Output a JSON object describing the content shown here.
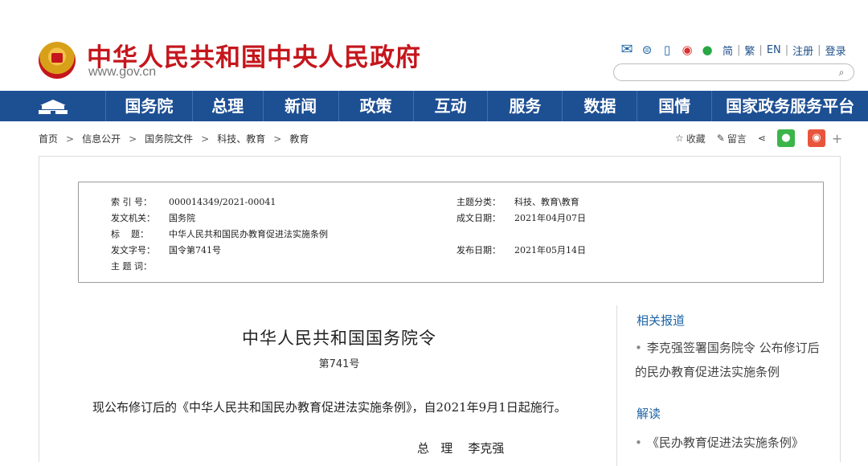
{
  "header": {
    "site_title": "中华人民共和国中央人民政府",
    "site_url": "www.gov.cn",
    "lang_links": [
      "简",
      "繁",
      "EN",
      "注册",
      "登录"
    ],
    "search_placeholder": ""
  },
  "nav": {
    "items": [
      "国务院",
      "总理",
      "新闻",
      "政策",
      "互动",
      "服务",
      "数据",
      "国情",
      "国家政务服务平台"
    ]
  },
  "breadcrumb": [
    "首页",
    "信息公开",
    "国务院文件",
    "科技、教育",
    "教育"
  ],
  "actions": {
    "favorite": "收藏",
    "comment": "留言"
  },
  "meta": {
    "index_label": "索 引 号：",
    "index_value": "000014349/2021-00041",
    "topic_label": "主题分类：",
    "topic_value": "科技、教育\\教育",
    "issuer_label": "发文机关：",
    "issuer_value": "国务院",
    "date_made_label": "成文日期：",
    "date_made_value": "2021年04月07日",
    "title_label": "标    题：",
    "title_value": "中华人民共和国民办教育促进法实施条例",
    "doc_no_label": "发文字号：",
    "doc_no_value": "国令第741号",
    "publish_label": "发布日期：",
    "publish_value": "2021年05月14日",
    "keywords_label": "主 题 词："
  },
  "article": {
    "title": "中华人民共和国国务院令",
    "number": "第741号",
    "body": "现公布修订后的《中华人民共和国民办教育促进法实施条例》，自2021年9月1日起施行。",
    "sign": "总   理    李克强"
  },
  "sidebar": {
    "related_title": "相关报道",
    "related_item": "李克强签署国务院令 公布修订后的民办教育促进法实施条例",
    "reading_title": "解读",
    "reading_item": "《民办教育促进法实施条例》"
  },
  "colors": {
    "brand_red": "#c4161c",
    "nav_blue": "#1d4f93",
    "link_blue": "#1d64a6"
  }
}
